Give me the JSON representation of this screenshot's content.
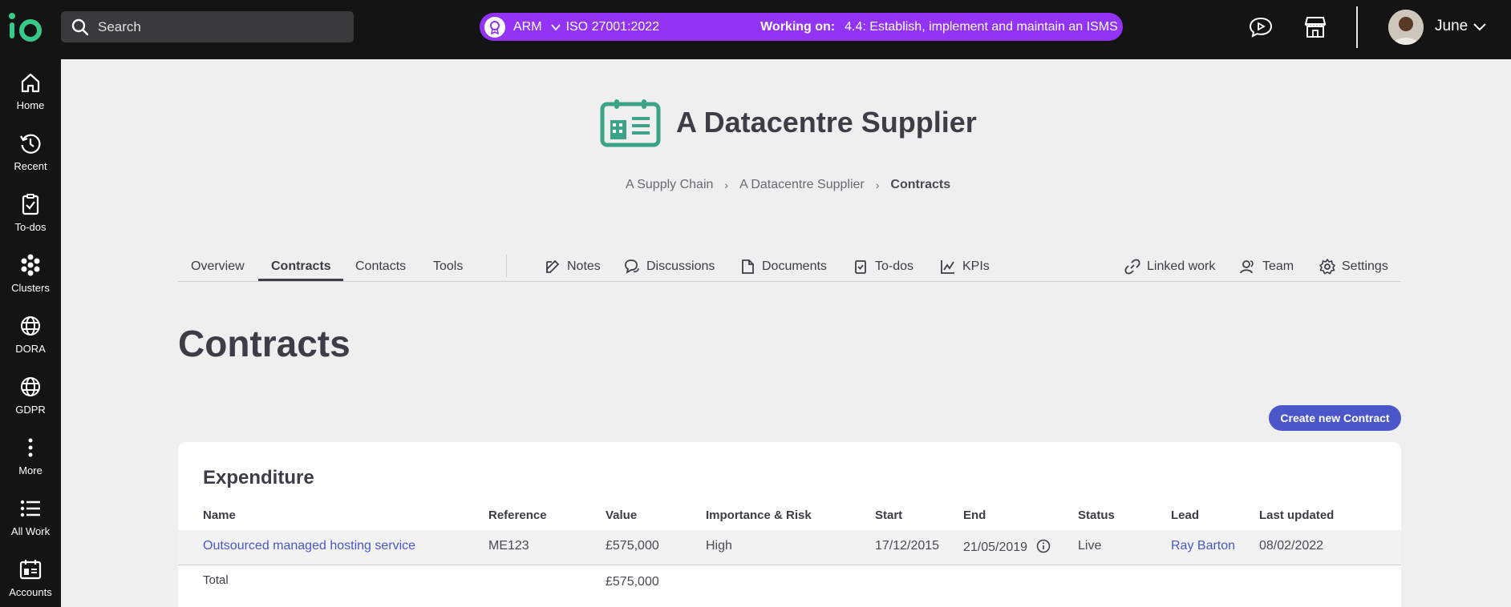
{
  "topbar": {
    "search_placeholder": "Search",
    "pill": {
      "framework_label": "ARM",
      "standard": "ISO 27001:2022",
      "working_label": "Working on:",
      "task": "4.4: Establish, implement and maintain an ISMS",
      "color": "#9233f5"
    },
    "icons": [
      "chat-play-icon",
      "storefront-icon"
    ],
    "user": {
      "name": "June"
    }
  },
  "sidebar": {
    "items": [
      {
        "label": "Home",
        "icon": "home-icon"
      },
      {
        "label": "Recent",
        "icon": "history-icon"
      },
      {
        "label": "To-dos",
        "icon": "clipboard-check-icon"
      },
      {
        "label": "Clusters",
        "icon": "clusters-icon"
      },
      {
        "label": "DORA",
        "icon": "globe-icon"
      },
      {
        "label": "GDPR",
        "icon": "globe-icon"
      },
      {
        "label": "More",
        "icon": "more-vertical-icon"
      },
      {
        "label": "All Work",
        "icon": "list-icon"
      },
      {
        "label": "Accounts",
        "icon": "accounts-icon"
      }
    ]
  },
  "hero": {
    "title": "A Datacentre Supplier",
    "icon": "supplier-calendar-icon",
    "accent": "#3aa38a"
  },
  "breadcrumb": [
    "A Supply Chain",
    "A Datacentre Supplier",
    "Contracts"
  ],
  "tabs": {
    "left": [
      "Overview",
      "Contracts",
      "Contacts",
      "Tools"
    ],
    "active": "Contracts",
    "middle": [
      "Notes",
      "Discussions",
      "Documents",
      "To-dos",
      "KPIs"
    ],
    "right": [
      "Linked work",
      "Team",
      "Settings"
    ]
  },
  "page": {
    "heading": "Contracts",
    "create_button": "Create new Contract",
    "button_color": "#4b57c9"
  },
  "expenditure": {
    "title": "Expenditure",
    "columns": [
      "Name",
      "Reference",
      "Value",
      "Importance & Risk",
      "Start",
      "End",
      "Status",
      "Lead",
      "Last updated"
    ],
    "rows": [
      {
        "name": "Outsourced managed hosting service",
        "reference": "ME123",
        "value": "£575,000",
        "importance": "High",
        "start": "17/12/2015",
        "end": "21/05/2019",
        "status": "Live",
        "lead": "Ray Barton",
        "updated": "08/02/2022"
      }
    ],
    "total_label": "Total",
    "total_value": "£575,000"
  }
}
